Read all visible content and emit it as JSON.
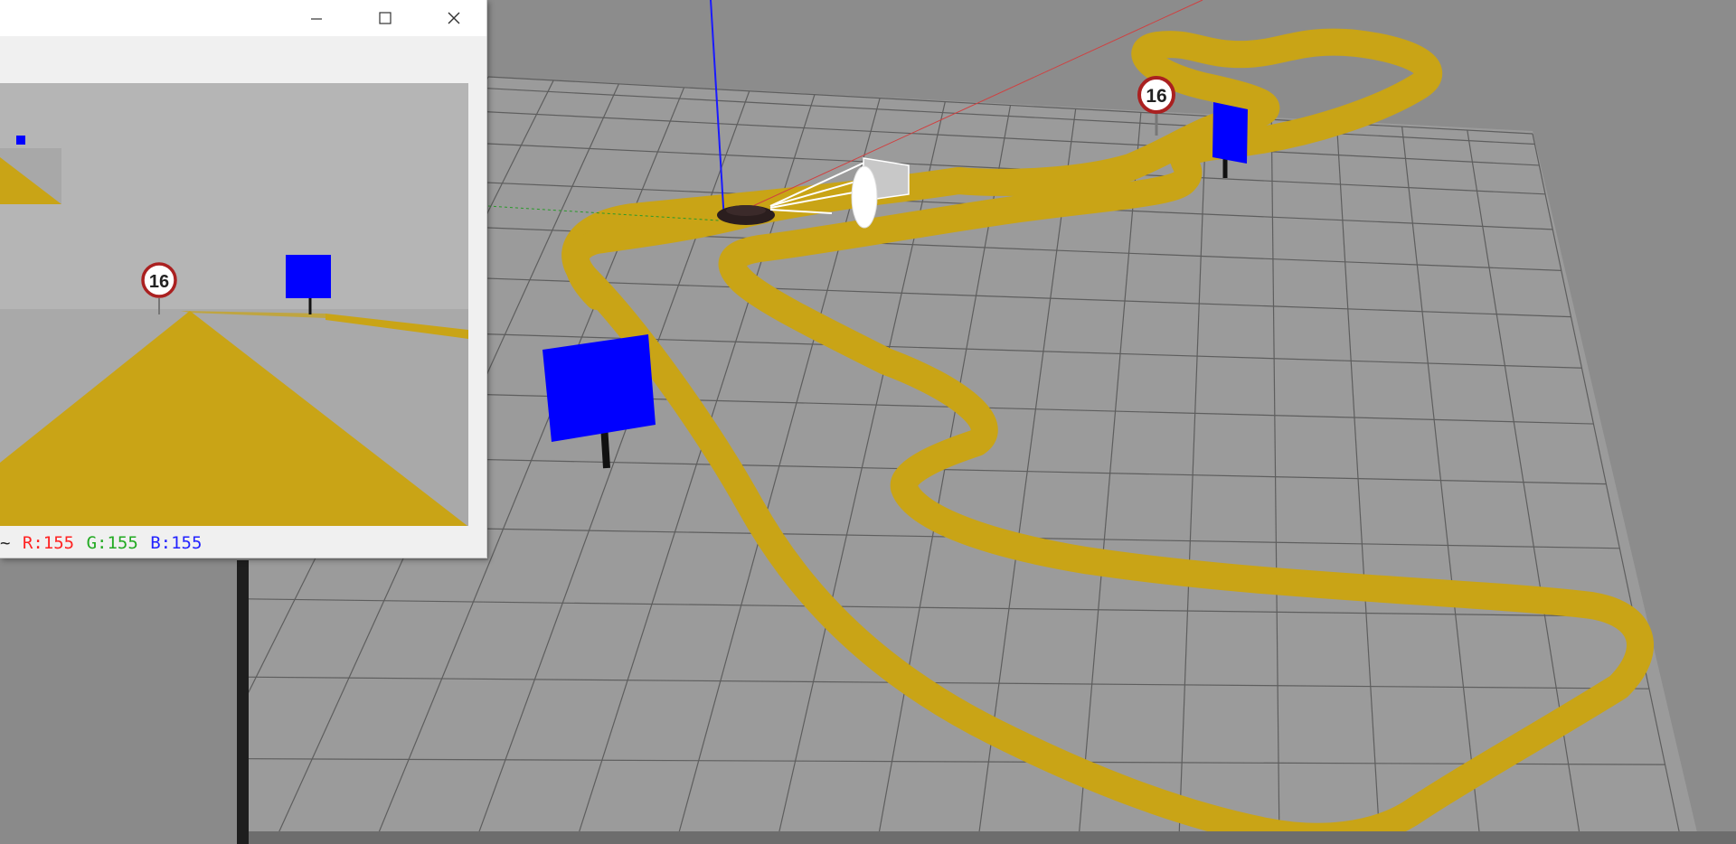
{
  "window": {
    "minimize_icon": "minimize-icon",
    "maximize_icon": "maximize-icon",
    "close_icon": "close-icon"
  },
  "camera_view": {
    "speed_sign_value": "16"
  },
  "status": {
    "prefix": "~",
    "r_text": "R:155",
    "g_text": "G:155",
    "b_text": "B:155",
    "r_color": "#ff2222",
    "g_color": "#22aa22",
    "b_color": "#2222ff"
  },
  "scene": {
    "speed_sign_value": "16",
    "track_color": "#c9a416",
    "sign_color": "#0000ff",
    "ground_color": "#9b9b9b"
  }
}
